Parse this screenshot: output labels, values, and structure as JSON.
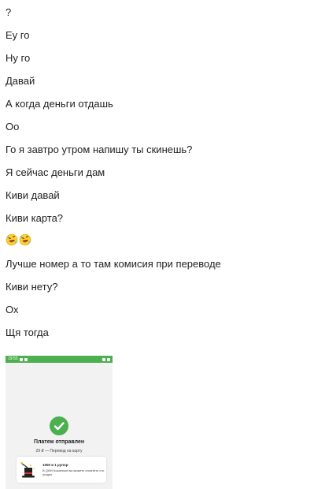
{
  "messages": [
    "?",
    "Еу го",
    "Ну го",
    "Давай",
    "А когда деньги отдашь",
    "Оо",
    "Го я завтро утром напишу ты скинешь?",
    "Я сейчас деньги дам",
    "Киви давай",
    "Киви карта?",
    "Лучше номер а то там комисия при переводе",
    "Киви нету?",
    "Ох",
    "Щя тогда"
  ],
  "emoji_message": [
    "rofl-emoji",
    "rofl-emoji"
  ],
  "attachment": {
    "status_time": "19:55",
    "title": "Платеж отправлен",
    "subtitle": "29 ₽ — Перевод на карту",
    "promo_title": "1000 в 1 рупор",
    "promo_text": "В QIWI Кошельке вы можете оплатить что угодно",
    "accent_color": "#4caf50"
  }
}
